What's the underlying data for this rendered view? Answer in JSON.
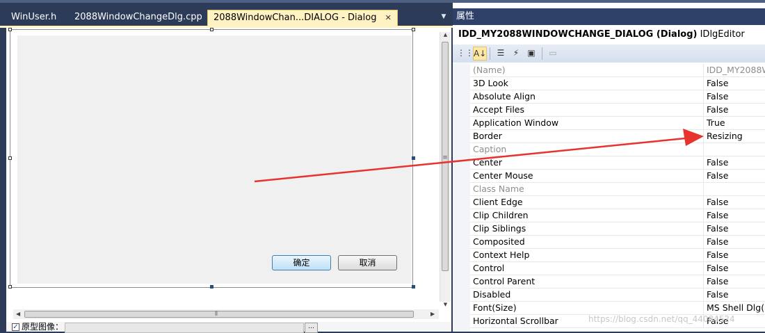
{
  "tabs": [
    {
      "label": "WinUser.h",
      "active": false
    },
    {
      "label": "2088WindowChangeDlg.cpp",
      "active": false
    },
    {
      "label": "2088WindowChan...DIALOG - Dialog",
      "active": true
    }
  ],
  "dialog": {
    "ok_label": "确定",
    "cancel_label": "取消"
  },
  "bottom_bar": {
    "prototype_label": "原型图像：",
    "prototype_checked": true
  },
  "properties": {
    "header": "属性",
    "object_name": "IDD_MY2088WINDOWCHANGE_DIALOG (Dialog)",
    "object_type": "IDlgEditor",
    "rows": [
      {
        "name": "(Name)",
        "value": "IDD_MY2088W",
        "state": "gray"
      },
      {
        "name": "3D Look",
        "value": "False"
      },
      {
        "name": "Absolute Align",
        "value": "False"
      },
      {
        "name": "Accept Files",
        "value": "False"
      },
      {
        "name": "Application Window",
        "value": "True"
      },
      {
        "name": "Border",
        "value": "Resizing"
      },
      {
        "name": "Caption",
        "value": "",
        "state": "disabled"
      },
      {
        "name": "Center",
        "value": "False"
      },
      {
        "name": "Center Mouse",
        "value": "False"
      },
      {
        "name": "Class Name",
        "value": "",
        "state": "disabled"
      },
      {
        "name": "Client Edge",
        "value": "False"
      },
      {
        "name": "Clip Children",
        "value": "False"
      },
      {
        "name": "Clip Siblings",
        "value": "False"
      },
      {
        "name": "Composited",
        "value": "False"
      },
      {
        "name": "Context Help",
        "value": "False"
      },
      {
        "name": "Control",
        "value": "False"
      },
      {
        "name": "Control Parent",
        "value": "False"
      },
      {
        "name": "Disabled",
        "value": "False"
      },
      {
        "name": "Font(Size)",
        "value": "MS Shell Dlg(9"
      },
      {
        "name": "Horizontal Scrollbar",
        "value": "False"
      }
    ]
  },
  "watermark": "https://blog.csdn.net/qq_44084524",
  "colors": {
    "ide_background": "#2b3b58",
    "active_tab": "#fff3c3",
    "annotation_arrow": "#e8322e"
  }
}
